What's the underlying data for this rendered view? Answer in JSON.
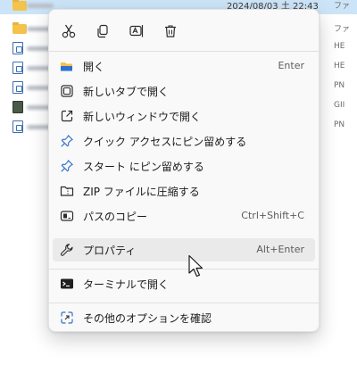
{
  "background": {
    "rows": [
      {
        "kind": "folder",
        "date": "2024/08/03 土 22:43",
        "type": "ファ"
      },
      {
        "kind": "folder",
        "date": "",
        "type": "ファ"
      },
      {
        "kind": "doc",
        "date": "",
        "type": "HE"
      },
      {
        "kind": "doc",
        "date": "",
        "type": "HE"
      },
      {
        "kind": "doc",
        "date": "",
        "type": "PN"
      },
      {
        "kind": "pic",
        "date": "",
        "type": "GII"
      },
      {
        "kind": "doc",
        "date": "",
        "type": "PN"
      }
    ]
  },
  "context_menu": {
    "quick_actions": [
      {
        "name": "cut",
        "icon": "scissors-icon"
      },
      {
        "name": "copy",
        "icon": "copy-icon"
      },
      {
        "name": "rename",
        "icon": "rename-icon"
      },
      {
        "name": "delete",
        "icon": "trash-icon"
      }
    ],
    "items": [
      {
        "label": "開く",
        "shortcut": "Enter",
        "icon": "folder-open-icon"
      },
      {
        "label": "新しいタブで開く",
        "shortcut": "",
        "icon": "new-tab-icon"
      },
      {
        "label": "新しいウィンドウで開く",
        "shortcut": "",
        "icon": "new-window-icon"
      },
      {
        "label": "クイック アクセスにピン留めする",
        "shortcut": "",
        "icon": "pin-icon"
      },
      {
        "label": "スタート にピン留めする",
        "shortcut": "",
        "icon": "pin-icon"
      },
      {
        "label": "ZIP ファイルに圧縮する",
        "shortcut": "",
        "icon": "zip-icon"
      },
      {
        "label": "パスのコピー",
        "shortcut": "Ctrl+Shift+C",
        "icon": "copy-path-icon"
      },
      {
        "label": "プロパティ",
        "shortcut": "Alt+Enter",
        "icon": "wrench-icon"
      },
      {
        "label": "ターミナルで開く",
        "shortcut": "",
        "icon": "terminal-icon"
      },
      {
        "label": "その他のオプションを確認",
        "shortcut": "",
        "icon": "more-options-icon"
      }
    ]
  }
}
